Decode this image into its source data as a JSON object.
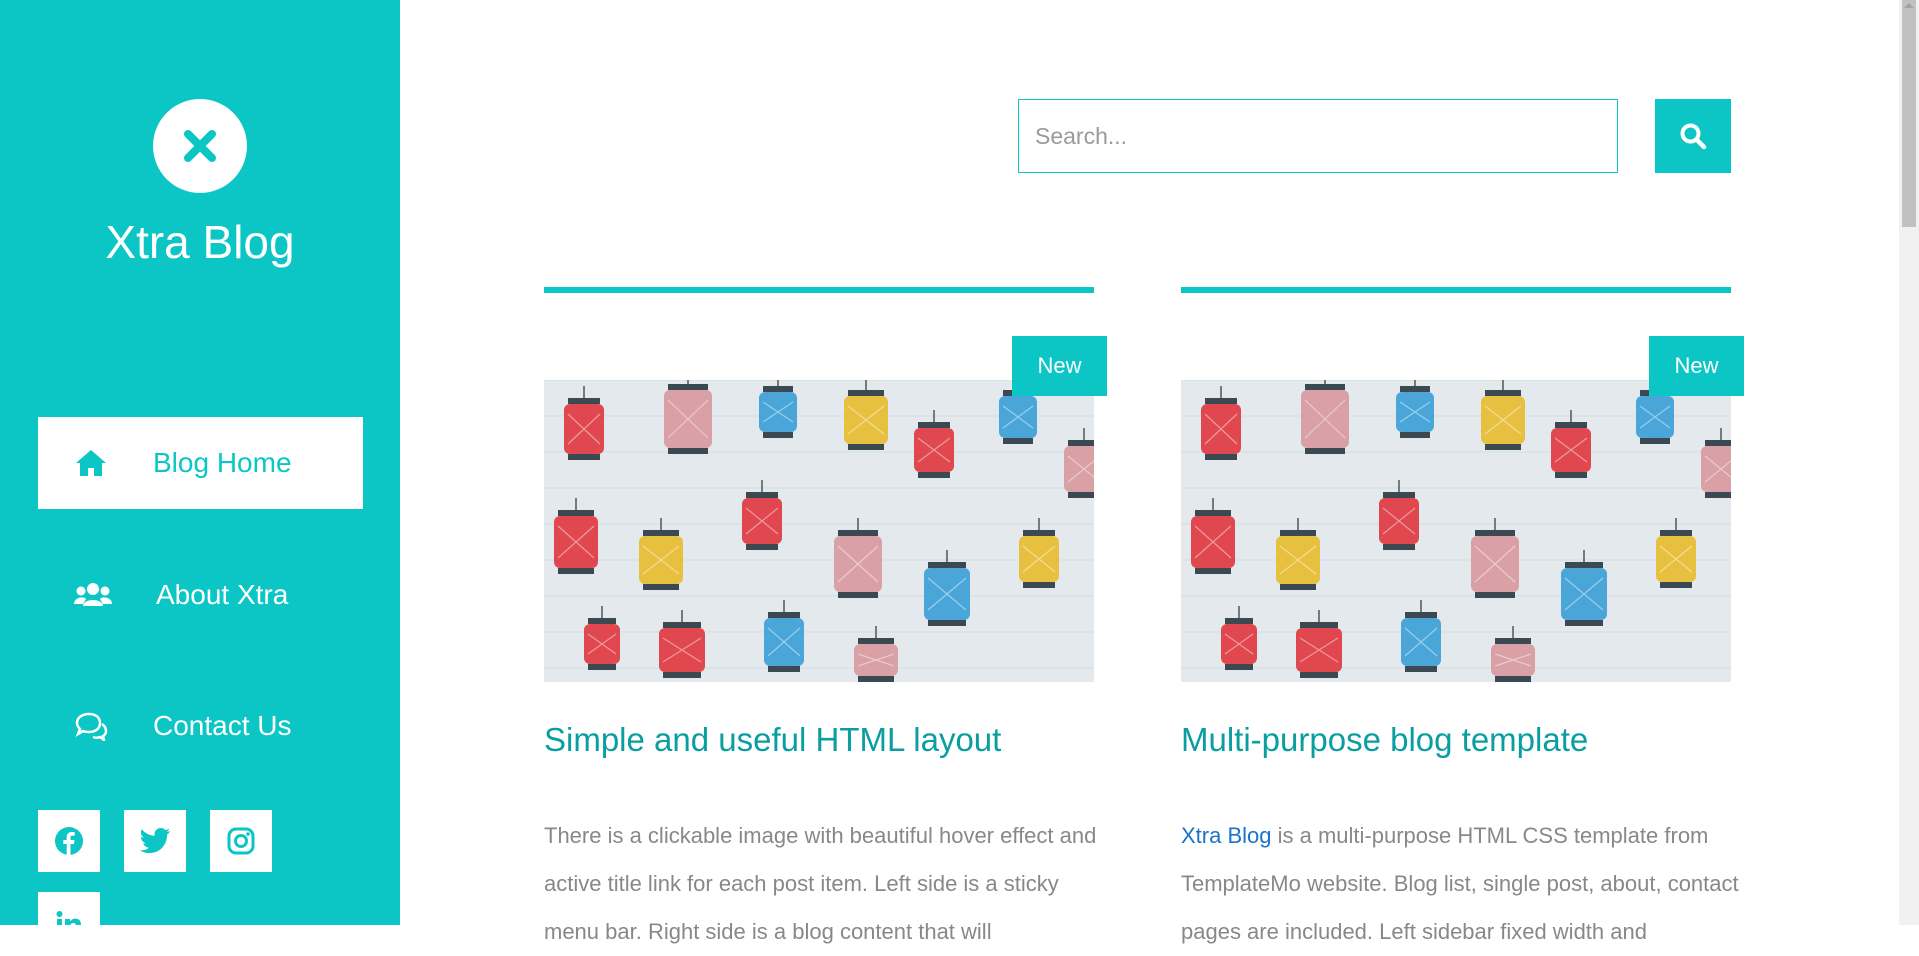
{
  "sidebar": {
    "site_title": "Xtra Blog",
    "nav": [
      {
        "label": "Blog Home",
        "icon": "home-icon",
        "active": true
      },
      {
        "label": "About Xtra",
        "icon": "users-icon",
        "active": false
      },
      {
        "label": "Contact Us",
        "icon": "comments-icon",
        "active": false
      }
    ],
    "social": [
      "facebook-icon",
      "twitter-icon",
      "instagram-icon",
      "linkedin-icon"
    ]
  },
  "search": {
    "placeholder": "Search...",
    "value": ""
  },
  "posts": [
    {
      "badge": "New",
      "title": "Simple and useful HTML layout",
      "excerpt": "There is a clickable image with beautiful hover effect and active title link for each post item. Left side is a sticky menu bar. Right side is a blog content that will"
    },
    {
      "badge": "New",
      "title": "Multi-purpose blog template",
      "excerpt_link": "Xtra Blog",
      "excerpt": " is a multi-purpose HTML CSS template from TemplateMo website. Blog list, single post, about, contact pages are included. Left sidebar fixed width and"
    }
  ],
  "colors": {
    "accent": "#0cc6c6",
    "title": "#099ea0",
    "body_text": "#888888",
    "link": "#1a73c9"
  }
}
